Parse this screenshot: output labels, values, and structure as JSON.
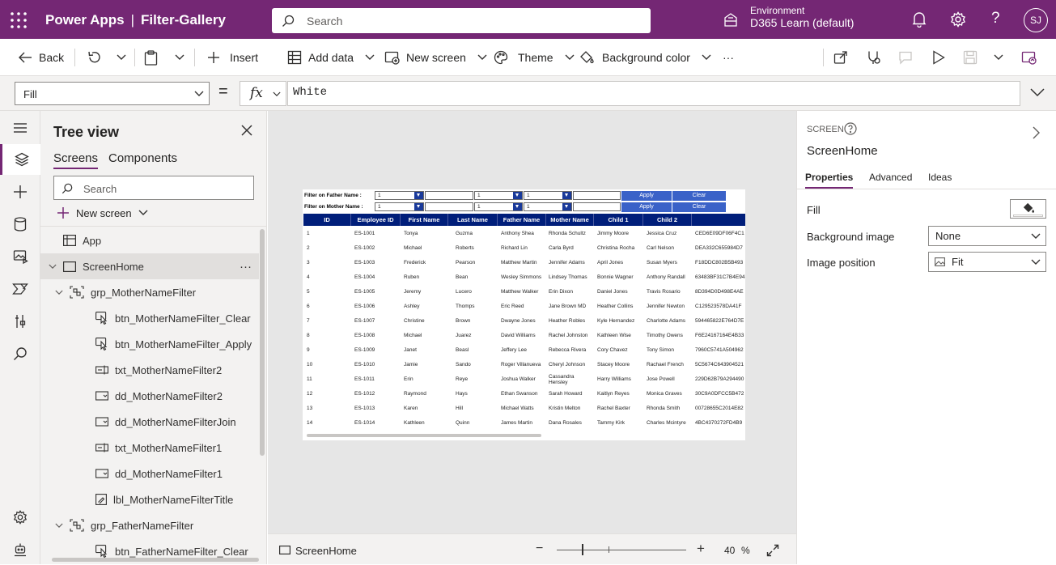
{
  "app": {
    "product": "Power Apps",
    "app_name": "Filter-Gallery",
    "search_placeholder": "Search",
    "environment_label": "Environment",
    "environment_value": "D365 Learn (default)",
    "user_initials": "SJ",
    "brand_color": "#742774"
  },
  "commands": {
    "back": "Back",
    "insert": "Insert",
    "add_data": "Add data",
    "new_screen": "New screen",
    "theme": "Theme",
    "background_color": "Background color",
    "more": "···"
  },
  "formula": {
    "property": "Fill",
    "equals": "=",
    "fx": "fx",
    "value": "White"
  },
  "tree": {
    "title": "Tree view",
    "tabs": [
      "Screens",
      "Components"
    ],
    "search_placeholder": "Search",
    "new_screen": "New screen",
    "nodes": [
      {
        "label": "App",
        "icon": "app-icon"
      },
      {
        "label": "ScreenHome",
        "icon": "screen-icon",
        "more": "···"
      },
      {
        "label": "grp_MotherNameFilter",
        "icon": "group-icon"
      },
      {
        "label": "btn_MotherNameFilter_Clear",
        "icon": "button-icon"
      },
      {
        "label": "btn_MotherNameFilter_Apply",
        "icon": "button-icon"
      },
      {
        "label": "txt_MotherNameFilter2",
        "icon": "textinput-icon"
      },
      {
        "label": "dd_MotherNameFilter2",
        "icon": "dropdown-icon"
      },
      {
        "label": "dd_MotherNameFilterJoin",
        "icon": "dropdown-icon"
      },
      {
        "label": "txt_MotherNameFilter1",
        "icon": "textinput-icon"
      },
      {
        "label": "dd_MotherNameFilter1",
        "icon": "dropdown-icon"
      },
      {
        "label": "lbl_MotherNameFilterTitle",
        "icon": "label-icon"
      },
      {
        "label": "grp_FatherNameFilter",
        "icon": "group-icon"
      },
      {
        "label": "btn_FatherNameFilter_Clear",
        "icon": "button-icon"
      }
    ]
  },
  "screen": {
    "father_filter_label": "Filter on Father Name :",
    "mother_filter_label": "Filter on Mother Name :",
    "father_dd1": "1",
    "father_dd2": "1",
    "father_dd3": "1",
    "mother_dd1": "1",
    "mother_dd2": "1",
    "mother_dd3": "1",
    "apply": "Apply",
    "clear": "Clear",
    "columns": [
      "ID",
      "Employee ID",
      "First Name",
      "Last Name",
      "Father Name",
      "Mother Name",
      "Child 1",
      "Child 2"
    ],
    "rows": [
      [
        "1",
        "ES-1001",
        "Tonya",
        "Guzma",
        "Anthony Shea",
        "Rhonda Schultz",
        "Jimmy Moore",
        "Jessica Cruz",
        "CED6E09DF06F4C1"
      ],
      [
        "2",
        "ES-1002",
        "Michael",
        "Roberts",
        "Richard Lin",
        "Carla Byrd",
        "Christina Rocha",
        "Carl Nelson",
        "DEA332C655984D7"
      ],
      [
        "3",
        "ES-1003",
        "Frederick",
        "Pearson",
        "Matthew Martin",
        "Jennifer Adams",
        "April Jones",
        "Susan Myers",
        "F18DDC802B5B493"
      ],
      [
        "4",
        "ES-1004",
        "Ruben",
        "Bean",
        "Wesley Simmons",
        "Lindsey Thomas",
        "Bonnie Wagner",
        "Anthony Randall",
        "63483BF31C7B4E94"
      ],
      [
        "5",
        "ES-1005",
        "Jeremy",
        "Lucero",
        "Matthew Walker",
        "Erin Dixon",
        "Daniel Jones",
        "Travis Rosario",
        "8D394D0D498E4AE"
      ],
      [
        "6",
        "ES-1006",
        "Ashley",
        "Thomps",
        "Eric Reed",
        "Jane Brown MD",
        "Heather Collins",
        "Jennifer Newton",
        "C129523578DA41F"
      ],
      [
        "7",
        "ES-1007",
        "Christine",
        "Brown",
        "Dwayne Jones",
        "Heather Robles",
        "Kyle Hernandez",
        "Charlotte Adams",
        "594465822E764D7E"
      ],
      [
        "8",
        "ES-1008",
        "Michael",
        "Juarez",
        "David Williams",
        "Rachel Johnston",
        "Kathleen Wise",
        "Timothy Owens",
        "F6E24167164E4B33"
      ],
      [
        "9",
        "ES-1009",
        "Janet",
        "Beasl",
        "Jeffery Lee",
        "Rebecca Rivera",
        "Cory Chavez",
        "Tony Simon",
        "7960C5741A504962"
      ],
      [
        "10",
        "ES-1010",
        "Jamie",
        "Sando",
        "Roger Villanueva",
        "Cheryl Johnson",
        "Stacey Moore",
        "Rachael French",
        "5C5674C643904521"
      ],
      [
        "11",
        "ES-1011",
        "Erin",
        "Reye",
        "Joshua Walker",
        "Cassandra Hensley",
        "Harry Williams",
        "Jose Powell",
        "229D62B79A294490"
      ],
      [
        "12",
        "ES-1012",
        "Raymond",
        "Hays",
        "Ethan Swanson",
        "Sarah Howard",
        "Kaitlyn Reyes",
        "Monica Graves",
        "30C9A0DFCC5B472"
      ],
      [
        "13",
        "ES-1013",
        "Karen",
        "Hill",
        "Michael Watts",
        "Kristin Melton",
        "Rachel Baxter",
        "Rhonda Smith",
        "00728655C2014E82"
      ],
      [
        "14",
        "ES-1014",
        "Kathleen",
        "Quinn",
        "James Martin",
        "Dana Rosales",
        "Tammy Kirk",
        "Charles Mcintyre",
        "4BC4370272FD4B9"
      ]
    ]
  },
  "status": {
    "screen_name": "ScreenHome",
    "zoom_minus": "−",
    "zoom_plus": "+",
    "zoom_value": "40",
    "zoom_unit": "%"
  },
  "properties": {
    "kind": "SCREEN",
    "name": "ScreenHome",
    "tabs": [
      "Properties",
      "Advanced",
      "Ideas"
    ],
    "fill_label": "Fill",
    "fill_value": "#ffffff",
    "background_image_label": "Background image",
    "background_image_value": "None",
    "image_position_label": "Image position",
    "image_position_value": "Fit"
  }
}
